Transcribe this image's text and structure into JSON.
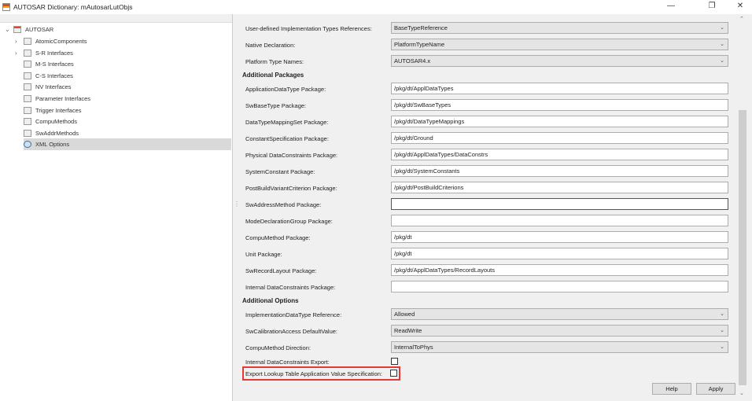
{
  "window": {
    "title": "AUTOSAR Dictionary: mAutosarLutObjs",
    "minimize": "—",
    "maximize": "❐",
    "close": "✕"
  },
  "tree": {
    "root": "AUTOSAR",
    "items": [
      {
        "label": "AtomicComponents",
        "expandable": true
      },
      {
        "label": "S-R Interfaces",
        "expandable": true
      },
      {
        "label": "M-S Interfaces",
        "expandable": false
      },
      {
        "label": "C-S Interfaces",
        "expandable": false
      },
      {
        "label": "NV Interfaces",
        "expandable": false
      },
      {
        "label": "Parameter Interfaces",
        "expandable": false
      },
      {
        "label": "Trigger Interfaces",
        "expandable": false
      },
      {
        "label": "CompuMethods",
        "expandable": false
      },
      {
        "label": "SwAddrMethods",
        "expandable": false
      },
      {
        "label": "XML Options",
        "expandable": false,
        "selected": true
      }
    ]
  },
  "top_fields": [
    {
      "label": "User-defined Implementation Types References:",
      "value": "BaseTypeReference",
      "type": "combo"
    },
    {
      "label": "Native Declaration:",
      "value": "PlatformTypeName",
      "type": "combo"
    },
    {
      "label": "Platform Type Names:",
      "value": "AUTOSAR4.x",
      "type": "combo"
    }
  ],
  "packages_heading": "Additional Packages",
  "packages": [
    {
      "label": "ApplicationDataType Package:",
      "value": "/pkg/dt/ApplDataTypes"
    },
    {
      "label": "SwBaseType Package:",
      "value": "/pkg/dt/SwBaseTypes"
    },
    {
      "label": "DataTypeMappingSet Package:",
      "value": "/pkg/dt/DataTypeMappings"
    },
    {
      "label": "ConstantSpecification Package:",
      "value": "/pkg/dt/Ground"
    },
    {
      "label": "Physical DataConstraints Package:",
      "value": "/pkg/dt/ApplDataTypes/DataConstrs"
    },
    {
      "label": "SystemConstant Package:",
      "value": "/pkg/dt/SystemConstants"
    },
    {
      "label": "PostBuildVariantCriterion Package:",
      "value": "/pkg/dt/PostBuildCriterions"
    },
    {
      "label": "SwAddressMethod Package:",
      "value": ""
    },
    {
      "label": "ModeDeclarationGroup Package:",
      "value": ""
    },
    {
      "label": "CompuMethod Package:",
      "value": "/pkg/dt"
    },
    {
      "label": "Unit Package:",
      "value": "/pkg/dt"
    },
    {
      "label": "SwRecordLayout Package:",
      "value": "/pkg/dt/ApplDataTypes/RecordLayouts"
    },
    {
      "label": "Internal DataConstraints Package:",
      "value": ""
    }
  ],
  "options_heading": "Additional Options",
  "options": [
    {
      "label": "ImplementationDataType Reference:",
      "value": "Allowed"
    },
    {
      "label": "SwCalibrationAccess DefaultValue:",
      "value": "ReadWrite"
    },
    {
      "label": "CompuMethod Direction:",
      "value": "InternalToPhys"
    }
  ],
  "checkboxes": [
    {
      "label": "Internal DataConstraints Export:",
      "checked": false
    },
    {
      "label": "Export Lookup Table Application Value Specification:",
      "checked": false
    }
  ],
  "buttons": {
    "help": "Help",
    "apply": "Apply"
  },
  "highlight_color": "#e53935"
}
